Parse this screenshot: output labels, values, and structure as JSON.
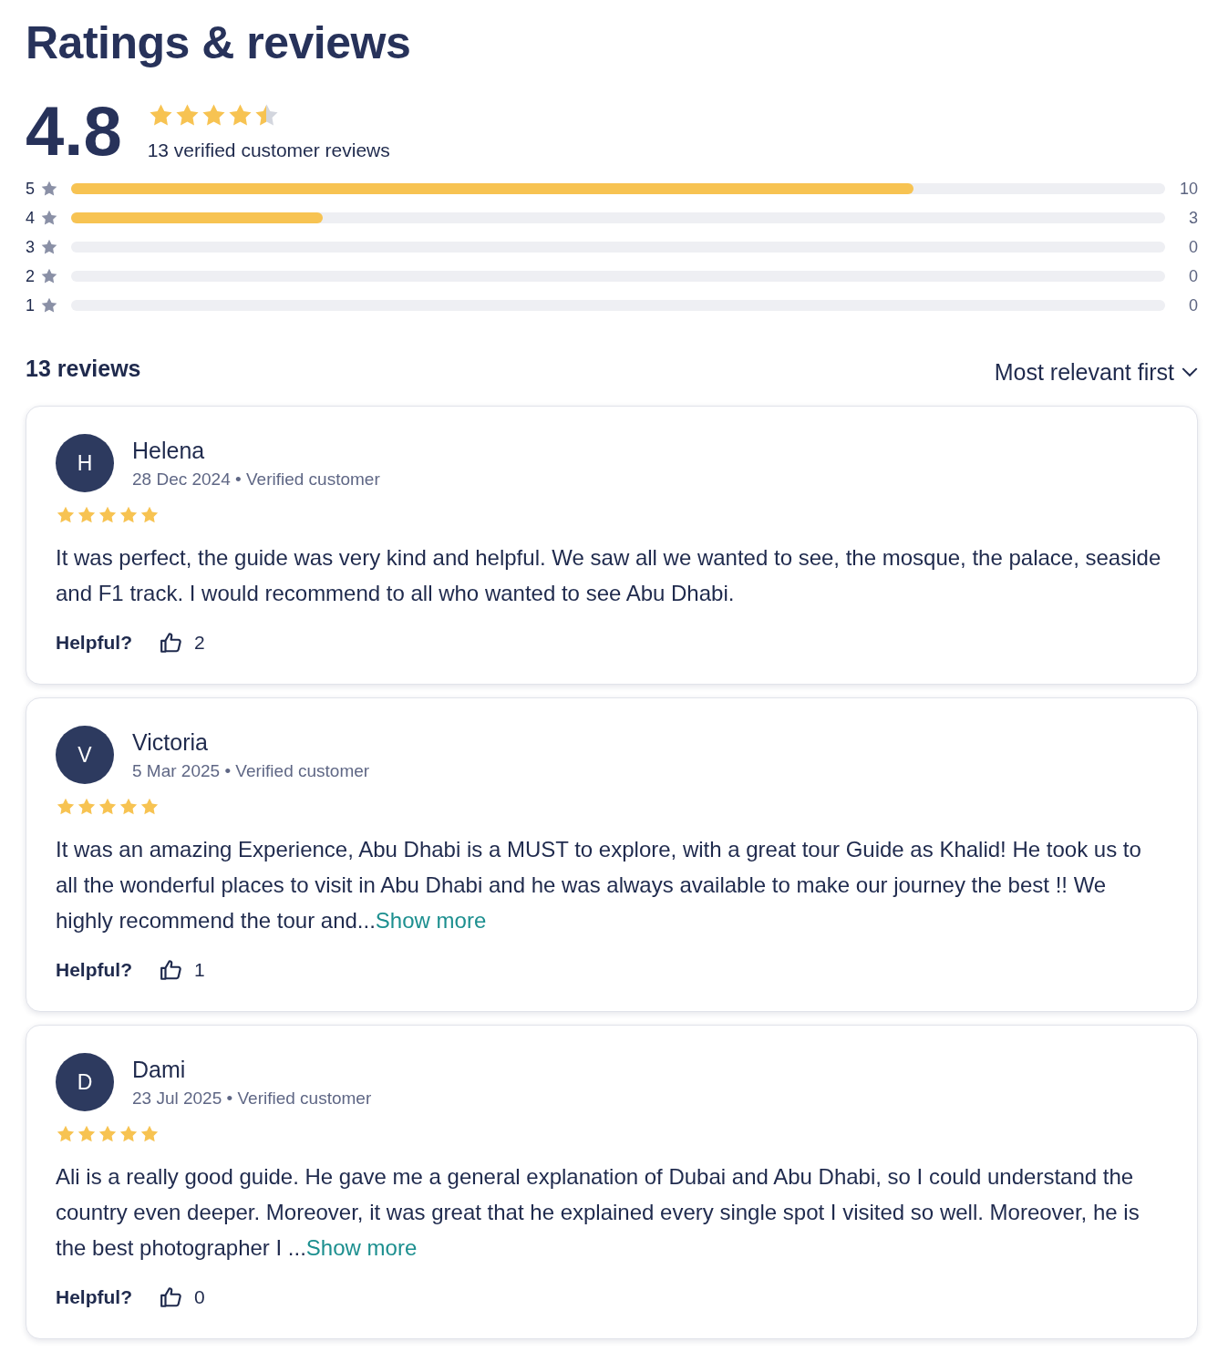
{
  "title": "Ratings & reviews",
  "summary": {
    "score": "4.8",
    "stars": 4.5,
    "caption": "13 verified customer reviews"
  },
  "distribution": [
    {
      "label": "5",
      "level": 0.77,
      "count": "10"
    },
    {
      "label": "4",
      "level": 0.23,
      "count": "3"
    },
    {
      "label": "3",
      "count": "0"
    },
    {
      "label": "2",
      "count": "0"
    },
    {
      "label": "1",
      "count": "0"
    }
  ],
  "reviews_header": {
    "count": "13 reviews",
    "sort": "Most relevant first"
  },
  "reviews": [
    {
      "initial": "H",
      "name": "Helena",
      "date": "28 Dec 2024",
      "separator": "•",
      "verified": "Verified customer",
      "stars": 5,
      "text": "It was perfect, the guide was very kind and helpful. We saw all we wanted to see, the mosque, the palace, seaside and F1 track. I would recommend to all who wanted to see Abu Dhabi.",
      "helpful_label": "Helpful?",
      "helpful_count": "2"
    },
    {
      "initial": "V",
      "name": "Victoria",
      "date": "5 Mar 2025",
      "separator": "•",
      "verified": "Verified customer",
      "stars": 5,
      "text": "It was an amazing Experience, Abu Dhabi is a MUST to explore, with a great tour Guide as Khalid! He took us to all the wonderful places to visit in Abu Dhabi and he was always available to make our journey the best !! We highly recommend the tour and...",
      "more": "Show more",
      "helpful_label": "Helpful?",
      "helpful_count": "1"
    },
    {
      "initial": "D",
      "name": "Dami",
      "date": "23 Jul 2025",
      "separator": "•",
      "verified": "Verified customer",
      "stars": 5,
      "text": "Ali is a really good guide. He gave me a general explanation of Dubai and Abu Dhabi, so I could understand the country even deeper. Moreover, it was great that he explained every single spot I visited so well. Moreover, he is the best photographer I ...",
      "more": "Show more",
      "helpful_label": "Helpful?",
      "helpful_count": "0"
    }
  ]
}
